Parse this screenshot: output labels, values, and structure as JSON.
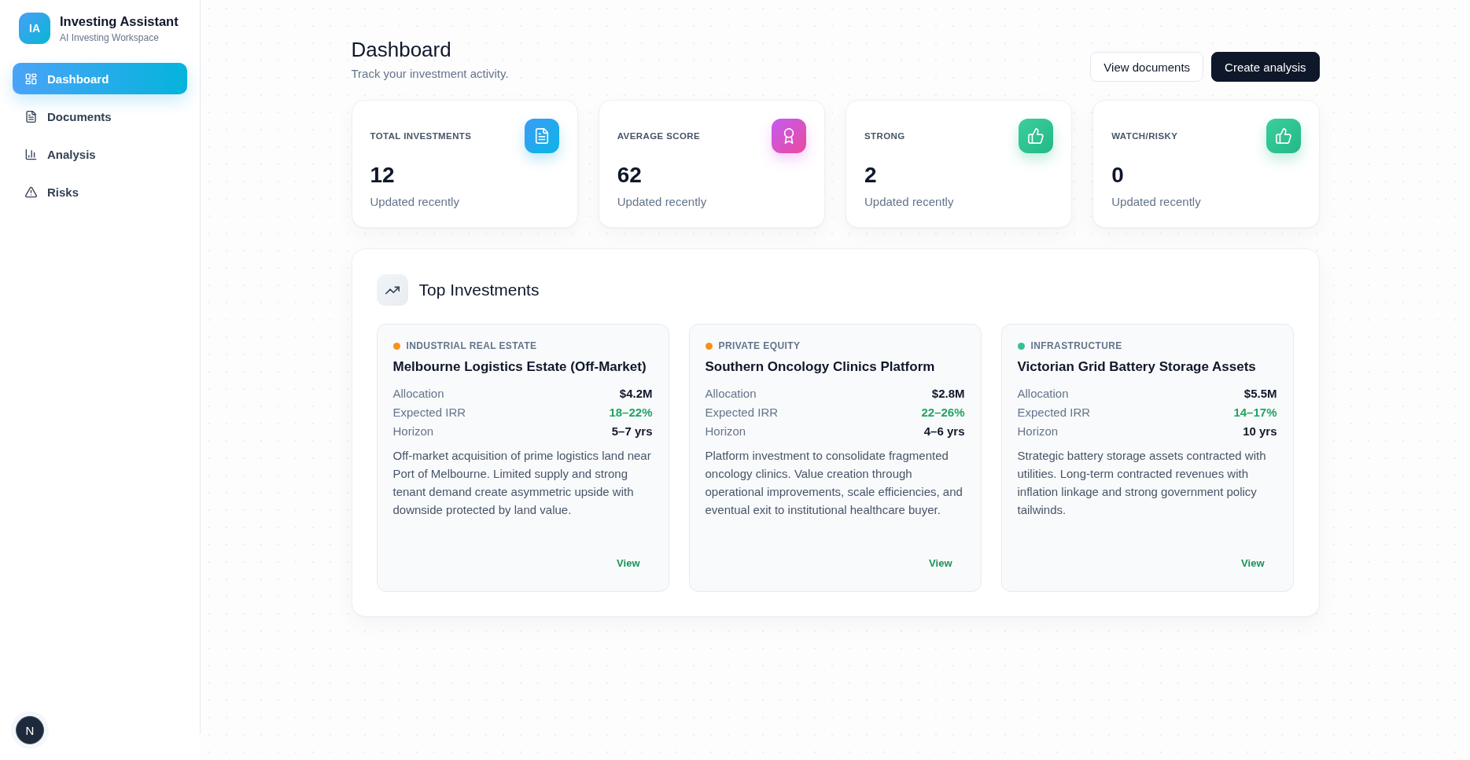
{
  "sidebar": {
    "logo": "IA",
    "title": "Investing Assistant",
    "subtitle": "AI Investing Workspace",
    "items": [
      {
        "label": "Dashboard",
        "selected": true
      },
      {
        "label": "Documents",
        "selected": false
      },
      {
        "label": "Analysis",
        "selected": false
      },
      {
        "label": "Risks",
        "selected": false
      }
    ]
  },
  "header": {
    "title": "Dashboard",
    "subtitle": "Track your investment activity.",
    "buttons": [
      {
        "label": "View documents",
        "kind": "secondary"
      },
      {
        "label": "Create analysis",
        "kind": "primary"
      }
    ]
  },
  "stats": [
    {
      "label": "TOTAL INVESTMENTS",
      "value": "12",
      "note": "Updated recently"
    },
    {
      "label": "AVERAGE SCORE",
      "value": "62",
      "note": "Updated recently"
    },
    {
      "label": "STRONG",
      "value": "2",
      "note": "Updated recently"
    },
    {
      "label": "WATCH/RISKY",
      "value": "0",
      "note": "Updated recently"
    }
  ],
  "top_investments": {
    "title": "Top Investments",
    "items": [
      {
        "category": "INDUSTRIAL REAL ESTATE",
        "color": "#f7931a",
        "name": "Melbourne Logistics Estate (Off-Market)",
        "metrics": [
          {
            "label": "Allocation",
            "value": "$4.2M",
            "kind": "plain"
          },
          {
            "label": "Expected IRR",
            "value": "18–22%",
            "kind": "positive"
          },
          {
            "label": "Horizon",
            "value": "5–7 yrs",
            "kind": "plain"
          }
        ],
        "description": "Off-market acquisition of prime logistics land near Port of Melbourne. Limited supply and strong tenant demand create asymmetric upside with downside protected by land value.",
        "action": "View"
      },
      {
        "category": "PRIVATE EQUITY",
        "color": "#f7931a",
        "name": "Southern Oncology Clinics Platform",
        "metrics": [
          {
            "label": "Allocation",
            "value": "$2.8M",
            "kind": "plain"
          },
          {
            "label": "Expected IRR",
            "value": "22–26%",
            "kind": "positive"
          },
          {
            "label": "Horizon",
            "value": "4–6 yrs",
            "kind": "plain"
          }
        ],
        "description": "Platform investment to consolidate fragmented oncology clinics. Value creation through operational improvements, scale efficiencies, and eventual exit to institutional healthcare buyer.",
        "action": "View"
      },
      {
        "category": "INFRASTRUCTURE",
        "color": "#34c38f",
        "name": "Victorian Grid Battery Storage Assets",
        "metrics": [
          {
            "label": "Allocation",
            "value": "$5.5M",
            "kind": "plain"
          },
          {
            "label": "Expected IRR",
            "value": "14–17%",
            "kind": "positive"
          },
          {
            "label": "Horizon",
            "value": "10 yrs",
            "kind": "plain"
          }
        ],
        "description": "Strategic battery storage assets contracted with utilities. Long-term contracted revenues with inflation linkage and strong government policy tailwinds.",
        "action": "View"
      }
    ]
  },
  "dev_indicator": {
    "label": "N"
  }
}
